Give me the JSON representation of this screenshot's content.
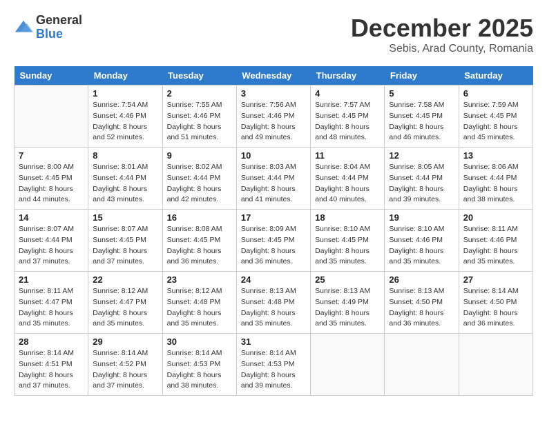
{
  "logo": {
    "general": "General",
    "blue": "Blue"
  },
  "title": "December 2025",
  "location": "Sebis, Arad County, Romania",
  "weekdays": [
    "Sunday",
    "Monday",
    "Tuesday",
    "Wednesday",
    "Thursday",
    "Friday",
    "Saturday"
  ],
  "weeks": [
    [
      {
        "day": "",
        "sunrise": "",
        "sunset": "",
        "daylight": ""
      },
      {
        "day": "1",
        "sunrise": "Sunrise: 7:54 AM",
        "sunset": "Sunset: 4:46 PM",
        "daylight": "Daylight: 8 hours and 52 minutes."
      },
      {
        "day": "2",
        "sunrise": "Sunrise: 7:55 AM",
        "sunset": "Sunset: 4:46 PM",
        "daylight": "Daylight: 8 hours and 51 minutes."
      },
      {
        "day": "3",
        "sunrise": "Sunrise: 7:56 AM",
        "sunset": "Sunset: 4:46 PM",
        "daylight": "Daylight: 8 hours and 49 minutes."
      },
      {
        "day": "4",
        "sunrise": "Sunrise: 7:57 AM",
        "sunset": "Sunset: 4:45 PM",
        "daylight": "Daylight: 8 hours and 48 minutes."
      },
      {
        "day": "5",
        "sunrise": "Sunrise: 7:58 AM",
        "sunset": "Sunset: 4:45 PM",
        "daylight": "Daylight: 8 hours and 46 minutes."
      },
      {
        "day": "6",
        "sunrise": "Sunrise: 7:59 AM",
        "sunset": "Sunset: 4:45 PM",
        "daylight": "Daylight: 8 hours and 45 minutes."
      }
    ],
    [
      {
        "day": "7",
        "sunrise": "Sunrise: 8:00 AM",
        "sunset": "Sunset: 4:45 PM",
        "daylight": "Daylight: 8 hours and 44 minutes."
      },
      {
        "day": "8",
        "sunrise": "Sunrise: 8:01 AM",
        "sunset": "Sunset: 4:44 PM",
        "daylight": "Daylight: 8 hours and 43 minutes."
      },
      {
        "day": "9",
        "sunrise": "Sunrise: 8:02 AM",
        "sunset": "Sunset: 4:44 PM",
        "daylight": "Daylight: 8 hours and 42 minutes."
      },
      {
        "day": "10",
        "sunrise": "Sunrise: 8:03 AM",
        "sunset": "Sunset: 4:44 PM",
        "daylight": "Daylight: 8 hours and 41 minutes."
      },
      {
        "day": "11",
        "sunrise": "Sunrise: 8:04 AM",
        "sunset": "Sunset: 4:44 PM",
        "daylight": "Daylight: 8 hours and 40 minutes."
      },
      {
        "day": "12",
        "sunrise": "Sunrise: 8:05 AM",
        "sunset": "Sunset: 4:44 PM",
        "daylight": "Daylight: 8 hours and 39 minutes."
      },
      {
        "day": "13",
        "sunrise": "Sunrise: 8:06 AM",
        "sunset": "Sunset: 4:44 PM",
        "daylight": "Daylight: 8 hours and 38 minutes."
      }
    ],
    [
      {
        "day": "14",
        "sunrise": "Sunrise: 8:07 AM",
        "sunset": "Sunset: 4:44 PM",
        "daylight": "Daylight: 8 hours and 37 minutes."
      },
      {
        "day": "15",
        "sunrise": "Sunrise: 8:07 AM",
        "sunset": "Sunset: 4:45 PM",
        "daylight": "Daylight: 8 hours and 37 minutes."
      },
      {
        "day": "16",
        "sunrise": "Sunrise: 8:08 AM",
        "sunset": "Sunset: 4:45 PM",
        "daylight": "Daylight: 8 hours and 36 minutes."
      },
      {
        "day": "17",
        "sunrise": "Sunrise: 8:09 AM",
        "sunset": "Sunset: 4:45 PM",
        "daylight": "Daylight: 8 hours and 36 minutes."
      },
      {
        "day": "18",
        "sunrise": "Sunrise: 8:10 AM",
        "sunset": "Sunset: 4:45 PM",
        "daylight": "Daylight: 8 hours and 35 minutes."
      },
      {
        "day": "19",
        "sunrise": "Sunrise: 8:10 AM",
        "sunset": "Sunset: 4:46 PM",
        "daylight": "Daylight: 8 hours and 35 minutes."
      },
      {
        "day": "20",
        "sunrise": "Sunrise: 8:11 AM",
        "sunset": "Sunset: 4:46 PM",
        "daylight": "Daylight: 8 hours and 35 minutes."
      }
    ],
    [
      {
        "day": "21",
        "sunrise": "Sunrise: 8:11 AM",
        "sunset": "Sunset: 4:47 PM",
        "daylight": "Daylight: 8 hours and 35 minutes."
      },
      {
        "day": "22",
        "sunrise": "Sunrise: 8:12 AM",
        "sunset": "Sunset: 4:47 PM",
        "daylight": "Daylight: 8 hours and 35 minutes."
      },
      {
        "day": "23",
        "sunrise": "Sunrise: 8:12 AM",
        "sunset": "Sunset: 4:48 PM",
        "daylight": "Daylight: 8 hours and 35 minutes."
      },
      {
        "day": "24",
        "sunrise": "Sunrise: 8:13 AM",
        "sunset": "Sunset: 4:48 PM",
        "daylight": "Daylight: 8 hours and 35 minutes."
      },
      {
        "day": "25",
        "sunrise": "Sunrise: 8:13 AM",
        "sunset": "Sunset: 4:49 PM",
        "daylight": "Daylight: 8 hours and 35 minutes."
      },
      {
        "day": "26",
        "sunrise": "Sunrise: 8:13 AM",
        "sunset": "Sunset: 4:50 PM",
        "daylight": "Daylight: 8 hours and 36 minutes."
      },
      {
        "day": "27",
        "sunrise": "Sunrise: 8:14 AM",
        "sunset": "Sunset: 4:50 PM",
        "daylight": "Daylight: 8 hours and 36 minutes."
      }
    ],
    [
      {
        "day": "28",
        "sunrise": "Sunrise: 8:14 AM",
        "sunset": "Sunset: 4:51 PM",
        "daylight": "Daylight: 8 hours and 37 minutes."
      },
      {
        "day": "29",
        "sunrise": "Sunrise: 8:14 AM",
        "sunset": "Sunset: 4:52 PM",
        "daylight": "Daylight: 8 hours and 37 minutes."
      },
      {
        "day": "30",
        "sunrise": "Sunrise: 8:14 AM",
        "sunset": "Sunset: 4:53 PM",
        "daylight": "Daylight: 8 hours and 38 minutes."
      },
      {
        "day": "31",
        "sunrise": "Sunrise: 8:14 AM",
        "sunset": "Sunset: 4:53 PM",
        "daylight": "Daylight: 8 hours and 39 minutes."
      },
      {
        "day": "",
        "sunrise": "",
        "sunset": "",
        "daylight": ""
      },
      {
        "day": "",
        "sunrise": "",
        "sunset": "",
        "daylight": ""
      },
      {
        "day": "",
        "sunrise": "",
        "sunset": "",
        "daylight": ""
      }
    ]
  ]
}
